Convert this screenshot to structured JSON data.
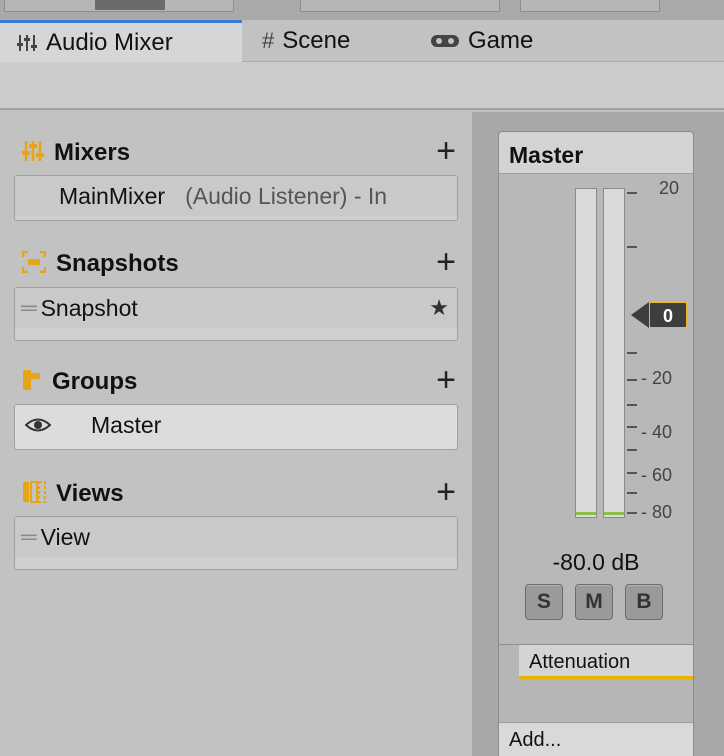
{
  "tabs": [
    {
      "label": "Audio Mixer",
      "icon": "mixer-sliders-icon",
      "active": true
    },
    {
      "label": "Scene",
      "icon": "grid-hash-icon",
      "active": false
    },
    {
      "label": "Game",
      "icon": "gamepad-icon",
      "active": false
    }
  ],
  "mixers": {
    "title": "Mixers",
    "items": [
      {
        "name": "MainMixer",
        "detail": "(Audio Listener) - In"
      }
    ]
  },
  "snapshots": {
    "title": "Snapshots",
    "items": [
      {
        "name": "Snapshot",
        "starred": true
      }
    ]
  },
  "groups": {
    "title": "Groups",
    "items": [
      {
        "name": "Master",
        "visible": true
      }
    ]
  },
  "views": {
    "title": "Views",
    "items": [
      {
        "name": "View"
      }
    ]
  },
  "strip": {
    "name": "Master",
    "fader_value": "0",
    "scale_labels": [
      "20",
      "- 20",
      "- 40",
      "- 60",
      "- 80"
    ],
    "level_text": "-80.0 dB",
    "solo_label": "S",
    "mute_label": "M",
    "bypass_label": "B",
    "effect_label": "Attenuation",
    "add_label": "Add..."
  },
  "colors": {
    "accent_orange": "#e8a317",
    "tab_active_blue": "#3a7ad5",
    "meter_green": "#8dbf4a"
  }
}
